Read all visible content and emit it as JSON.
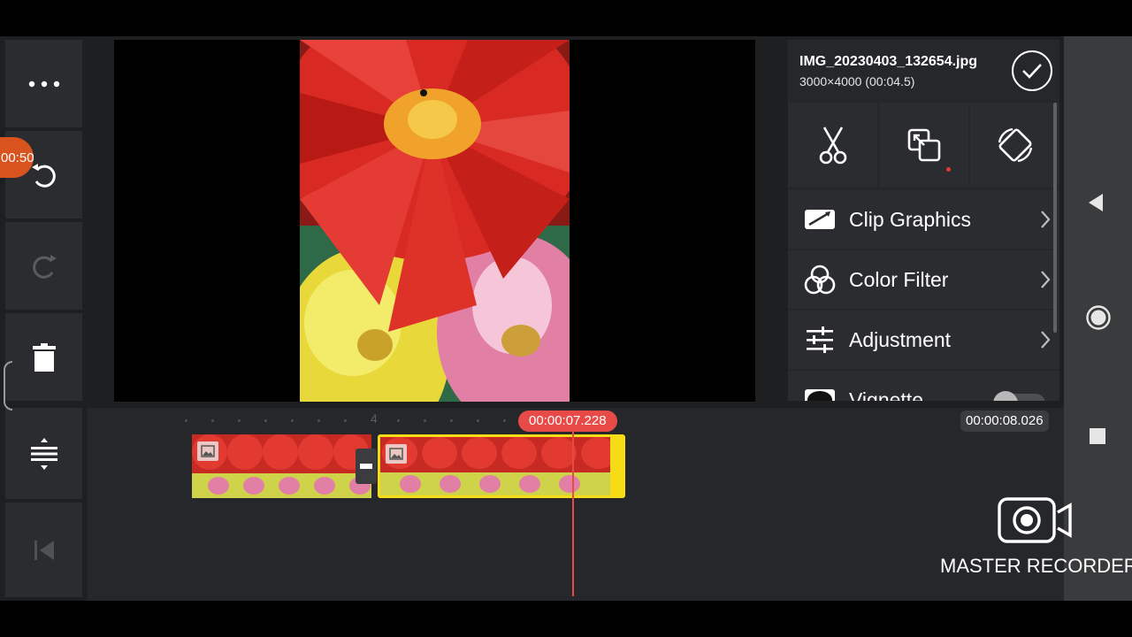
{
  "recording_badge": {
    "time": "00:50"
  },
  "left_toolbar": {
    "icons": [
      "more-icon",
      "undo-icon",
      "redo-icon",
      "delete-icon",
      "expand-tracks-icon",
      "jump-to-start-icon"
    ]
  },
  "right_panel": {
    "file_name": "IMG_20230403_132654.jpg",
    "file_info": "3000×4000 (00:04.5)",
    "tools": [
      "scissors-icon",
      "crop-icon",
      "rotate-icon"
    ],
    "menu": [
      {
        "label": "Clip Graphics",
        "icon": "clip-graphics-icon"
      },
      {
        "label": "Color Filter",
        "icon": "color-filter-icon"
      },
      {
        "label": "Adjustment",
        "icon": "adjustment-icon"
      },
      {
        "label": "Vignette",
        "icon": "vignette-icon",
        "toggle": false
      }
    ]
  },
  "timeline": {
    "ruler_label": "4",
    "current_time": "00:00:07.228",
    "total_time": "00:00:08.026"
  },
  "watermark": {
    "text": "MASTER RECORDER"
  },
  "colors": {
    "accent_red": "#e84b47",
    "selection_yellow": "#f6dc16",
    "recording_orange": "#d9531e"
  }
}
